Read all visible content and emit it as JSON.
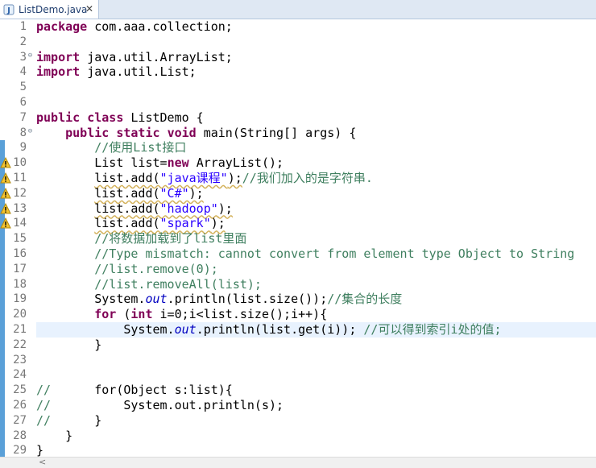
{
  "tab": {
    "title": "ListDemo.java",
    "close": "✕"
  },
  "lines": [
    {
      "n": "1",
      "segs": [
        [
          "kw",
          "package"
        ],
        [
          "",
          "com.aaa.collection;"
        ]
      ]
    },
    {
      "n": "2",
      "segs": []
    },
    {
      "n": "3",
      "fold": true,
      "segs": [
        [
          "kw",
          "import"
        ],
        [
          "",
          "java.util.ArrayList;"
        ]
      ]
    },
    {
      "n": "4",
      "segs": [
        [
          "kw",
          "import"
        ],
        [
          "",
          "java.util.List;"
        ]
      ]
    },
    {
      "n": "5",
      "segs": []
    },
    {
      "n": "6",
      "segs": []
    },
    {
      "n": "7",
      "segs": [
        [
          "kw",
          "public"
        ],
        [
          "",
          ""
        ],
        [
          "kw",
          "class"
        ],
        [
          "",
          "ListDemo {"
        ]
      ]
    },
    {
      "n": "8",
      "fold": true,
      "segs": [
        [
          "",
          "    "
        ],
        [
          "kw",
          "public"
        ],
        [
          "",
          ""
        ],
        [
          "kw",
          "static"
        ],
        [
          "",
          ""
        ],
        [
          "kw",
          "void"
        ],
        [
          "",
          "main(String[] args) {"
        ]
      ]
    },
    {
      "n": "9",
      "segs": [
        [
          "",
          "        "
        ],
        [
          "cm",
          "//使用List接口"
        ]
      ]
    },
    {
      "n": "10",
      "warn": true,
      "segs": [
        [
          "",
          "        List list="
        ],
        [
          "kw",
          "new"
        ],
        [
          "",
          "ArrayList();"
        ]
      ]
    },
    {
      "n": "11",
      "warn": true,
      "segs": [
        [
          "",
          "        "
        ],
        [
          "w",
          "list.add("
        ],
        [
          "wstr",
          "\"java课程\""
        ],
        [
          "w",
          ");"
        ],
        [
          "cm",
          "//我们加入的是字符串."
        ]
      ]
    },
    {
      "n": "12",
      "warn": true,
      "segs": [
        [
          "",
          "        "
        ],
        [
          "w",
          "list.add("
        ],
        [
          "wstr",
          "\"C#\""
        ],
        [
          "w",
          ");"
        ]
      ]
    },
    {
      "n": "13",
      "warn": true,
      "segs": [
        [
          "",
          "        "
        ],
        [
          "w",
          "list.add("
        ],
        [
          "wstr",
          "\"hadoop\""
        ],
        [
          "w",
          ");"
        ]
      ]
    },
    {
      "n": "14",
      "warn": true,
      "segs": [
        [
          "",
          "        "
        ],
        [
          "w",
          "list.add("
        ],
        [
          "wstr",
          "\"spark\""
        ],
        [
          "w",
          ");"
        ]
      ]
    },
    {
      "n": "15",
      "segs": [
        [
          "",
          "        "
        ],
        [
          "cm",
          "//将数据加载到了list里面"
        ]
      ]
    },
    {
      "n": "16",
      "segs": [
        [
          "",
          "        "
        ],
        [
          "cm",
          "//Type mismatch: cannot convert from element type Object to String"
        ]
      ]
    },
    {
      "n": "17",
      "segs": [
        [
          "",
          "        "
        ],
        [
          "cm",
          "//list.remove(0);"
        ]
      ]
    },
    {
      "n": "18",
      "segs": [
        [
          "",
          "        "
        ],
        [
          "cm",
          "//list.removeAll(list);"
        ]
      ]
    },
    {
      "n": "19",
      "segs": [
        [
          "",
          "        System."
        ],
        [
          "fld",
          "out"
        ],
        [
          "",
          ".println(list.size());"
        ],
        [
          "cm",
          "//集合的长度"
        ]
      ]
    },
    {
      "n": "20",
      "segs": [
        [
          "",
          "        "
        ],
        [
          "kw",
          "for"
        ],
        [
          "",
          "("
        ],
        [
          "kw",
          "int"
        ],
        [
          "",
          "i=0;i<list.size();i++){"
        ]
      ]
    },
    {
      "n": "21",
      "current": true,
      "segs": [
        [
          "",
          "            System."
        ],
        [
          "fld",
          "out"
        ],
        [
          "",
          ".println(list.get(i)); "
        ],
        [
          "cm",
          "//可以得到索引i处的值;"
        ]
      ]
    },
    {
      "n": "22",
      "segs": [
        [
          "",
          "        }"
        ]
      ]
    },
    {
      "n": "23",
      "segs": []
    },
    {
      "n": "24",
      "segs": []
    },
    {
      "n": "25",
      "segs": [
        [
          "cm",
          "//"
        ],
        [
          "",
          "      for(Object s:list){"
        ]
      ]
    },
    {
      "n": "26",
      "segs": [
        [
          "cm",
          "//"
        ],
        [
          "",
          "          System.out.println(s);"
        ]
      ]
    },
    {
      "n": "27",
      "segs": [
        [
          "cm",
          "//"
        ],
        [
          "",
          "      }"
        ]
      ]
    },
    {
      "n": "28",
      "segs": [
        [
          "",
          "    }"
        ]
      ]
    },
    {
      "n": "29",
      "segs": [
        [
          "",
          "}"
        ]
      ]
    }
  ],
  "colors": {
    "ruler": "#5aa0d8",
    "current_line": "#e8f2fe"
  },
  "scrollbar": {
    "left_arrow": "<"
  }
}
